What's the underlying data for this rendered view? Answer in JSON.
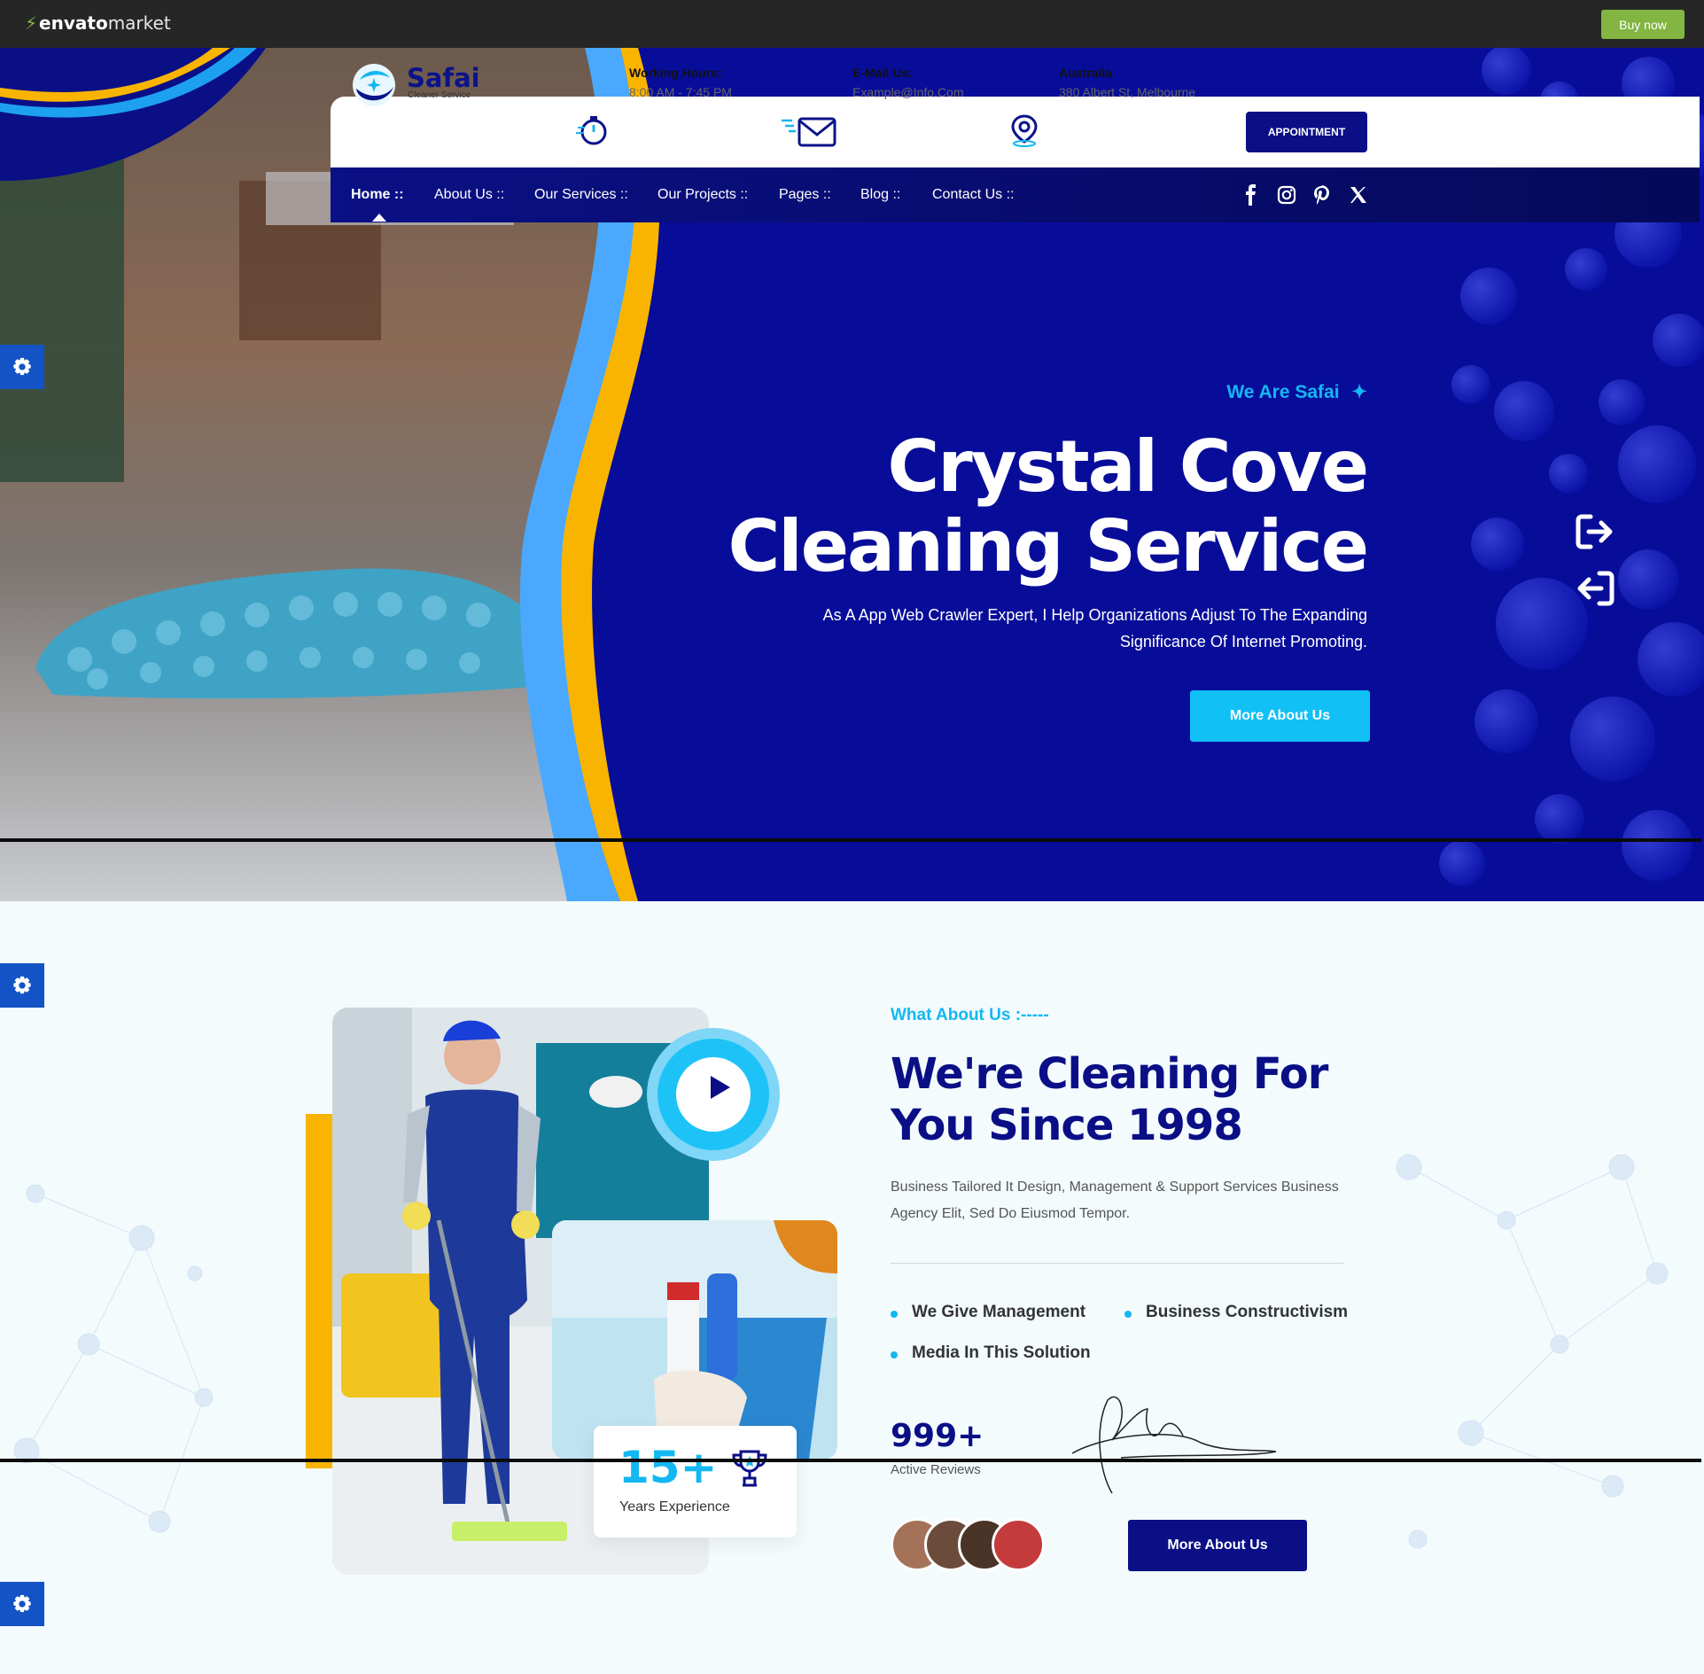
{
  "envato": {
    "logo_bold": "envato",
    "logo_light": "market",
    "buy_now": "Buy now"
  },
  "brand": {
    "name": "Safai",
    "tagline": "Cleaner Service",
    "primary_color": "#0a0f86",
    "accent_color": "#14b7f2",
    "highlight_color": "#f8b400"
  },
  "header_info": {
    "hours": {
      "title": "Working Hours:",
      "value": "8:00 AM - 7:45 PM",
      "icon": "stopwatch-icon"
    },
    "email": {
      "title": "E-Mail Us:",
      "value": "Example@Info.Com",
      "icon": "envelope-icon"
    },
    "location": {
      "title": "Australia",
      "value": "380 Albert St, Melbourne",
      "icon": "map-pin-icon"
    }
  },
  "appointment_label": "APPOINTMENT",
  "nav": {
    "items": [
      {
        "label": "Home ::",
        "active": true
      },
      {
        "label": "About Us ::"
      },
      {
        "label": "Our Services ::"
      },
      {
        "label": "Our Projects ::"
      },
      {
        "label": "Pages ::"
      },
      {
        "label": "Blog ::"
      },
      {
        "label": "Contact Us ::"
      }
    ],
    "social": [
      "facebook-icon",
      "instagram-icon",
      "pinterest-icon",
      "x-twitter-icon"
    ]
  },
  "hero": {
    "eyebrow": "We Are Safai",
    "title_line1": "Crystal Cove",
    "title_line2": "Cleaning Service",
    "subtitle_line1": "As A App Web Crawler Expert, I Help Organizations Adjust To The Expanding",
    "subtitle_line2": "Significance Of Internet Promoting.",
    "button": "More About Us"
  },
  "about": {
    "eyebrow": "What About Us :-----",
    "title_line1": "We're Cleaning For",
    "title_line2": "You Since 1998",
    "desc_line1": "Business Tailored It Design, Management & Support Services Business",
    "desc_line2": "Agency Elit, Sed Do Eiusmod Tempor.",
    "features": [
      "We Give Management",
      "Business Constructivism",
      "Media In This Solution"
    ],
    "reviews_value": "999+",
    "reviews_label": "Active Reviews",
    "experience_value": "15+",
    "experience_label": "Years Experience",
    "button": "More About Us"
  }
}
